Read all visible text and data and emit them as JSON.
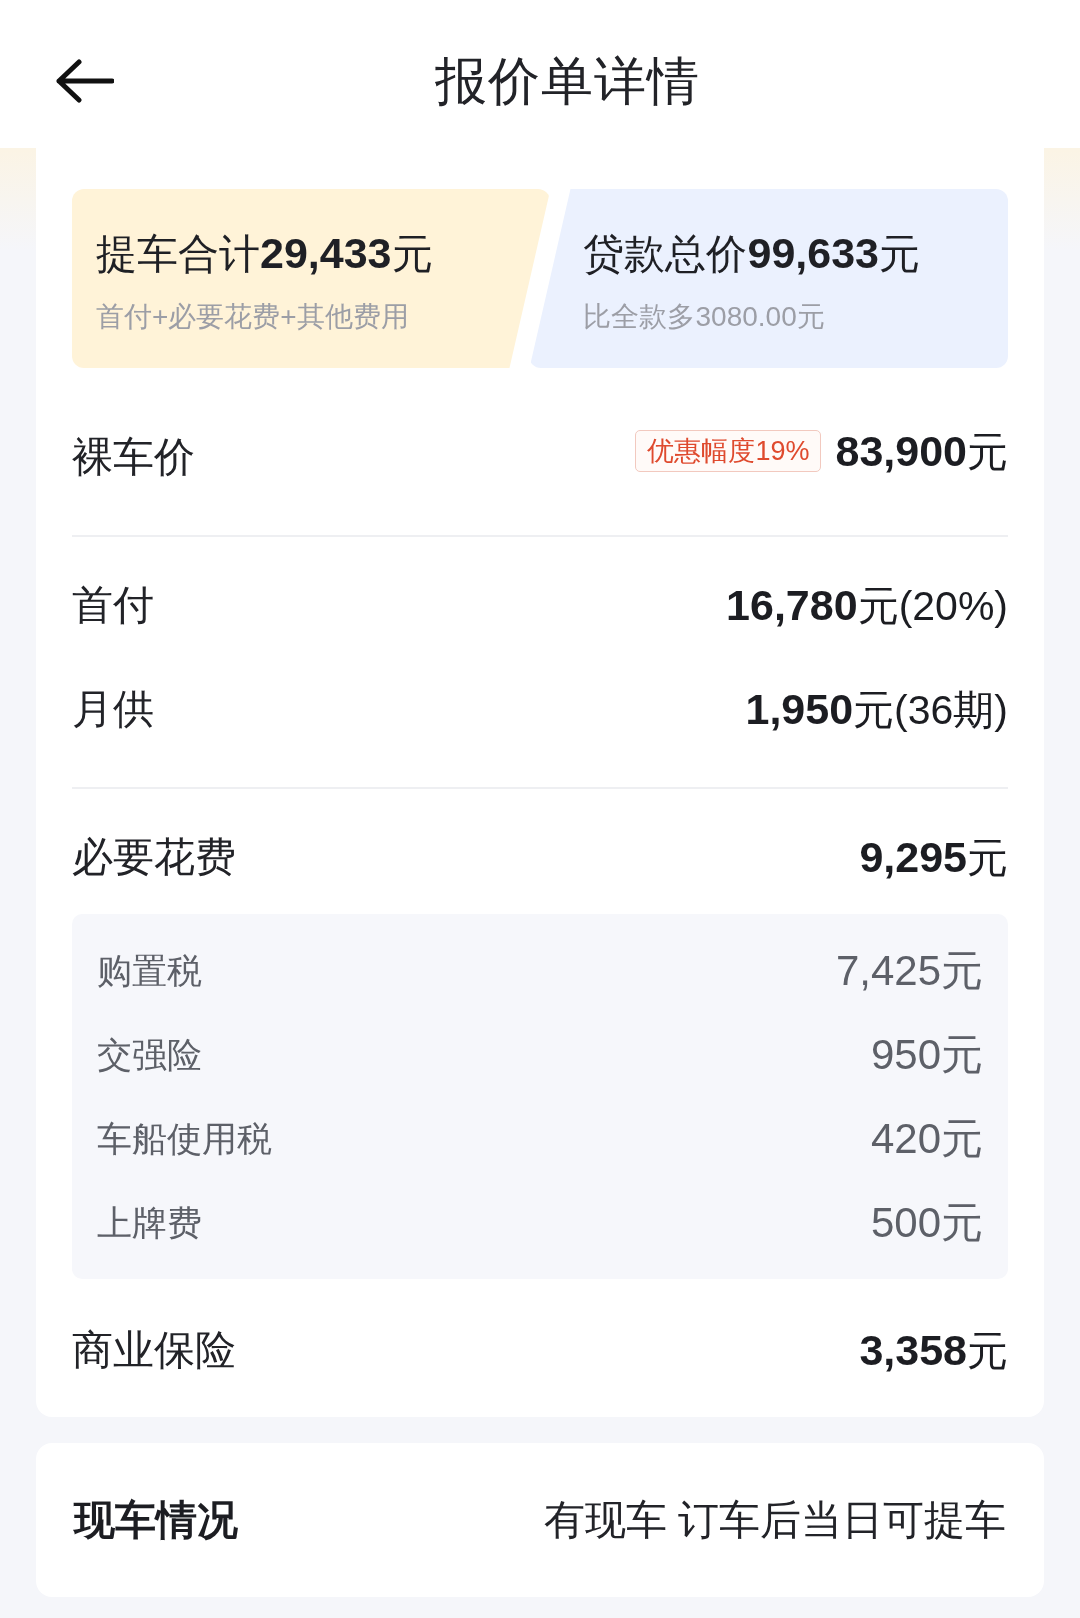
{
  "header": {
    "title": "报价单详情"
  },
  "summary": [
    {
      "kind": "pickup",
      "title": "提车合计**29,433**元",
      "note": "首付+必要花费+其他费用"
    },
    {
      "kind": "loan",
      "title": "贷款总价**99,633**元",
      "note": "比全款多3080.00元"
    }
  ],
  "sections": [
    {
      "rows": [
        {
          "label": "裸车价",
          "badge": "优惠幅度19%",
          "value": "**83,900**元"
        }
      ]
    },
    {
      "rows": [
        {
          "label": "首付",
          "value": "**16,780**元(20%)"
        },
        {
          "label": "月供",
          "value": "**1,950**元(36期)"
        }
      ]
    },
    {
      "rows": [
        {
          "label": "必要花费",
          "value": "**9,295**元",
          "details": [
            {
              "label": "购置税",
              "value": "7,425元"
            },
            {
              "label": "交强险",
              "value": "950元"
            },
            {
              "label": "车船使用税",
              "value": "420元"
            },
            {
              "label": "上牌费",
              "value": "500元"
            }
          ]
        },
        {
          "label": "商业保险",
          "value": "**3,358**元"
        }
      ]
    }
  ],
  "stock": {
    "label": "现车情况",
    "value": "有现车 订车后当日可提车"
  }
}
